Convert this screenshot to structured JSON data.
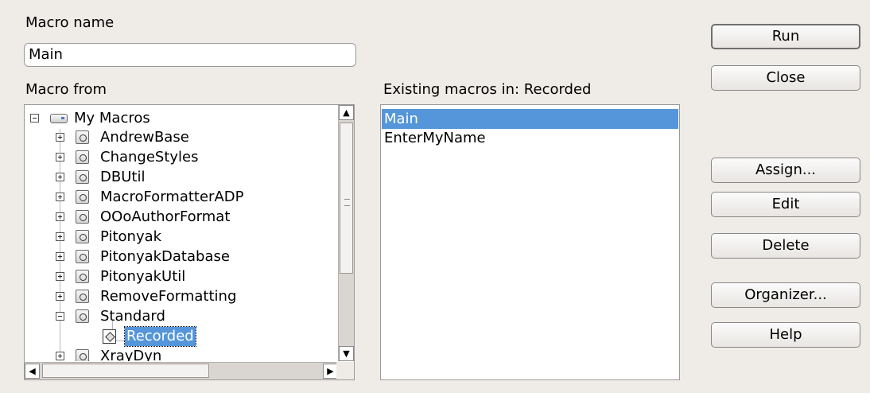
{
  "macro_name": {
    "label": "Macro name",
    "value": "Main"
  },
  "macro_from": {
    "label": "Macro from"
  },
  "tree": {
    "root": "My Macros",
    "libraries": [
      "AndrewBase",
      "ChangeStyles",
      "DBUtil",
      "MacroFormatterADP",
      "OOoAuthorFormat",
      "Pitonyak",
      "PitonyakDatabase",
      "PitonyakUtil",
      "RemoveFormatting",
      "Standard",
      "XrayDyn"
    ],
    "selected_module": "Recorded"
  },
  "existing_macros": {
    "label": "Existing macros in: Recorded",
    "items": [
      "Main",
      "EnterMyName"
    ],
    "selected": "Main"
  },
  "buttons": {
    "run": "Run",
    "close": "Close",
    "assign": "Assign...",
    "edit": "Edit",
    "delete": "Delete",
    "organizer": "Organizer...",
    "help": "Help"
  },
  "colors": {
    "selection": "#5496d9",
    "background": "#efebe7"
  },
  "icons": {
    "root": "drive-icon",
    "library": "library-icon",
    "module": "module-icon",
    "expand": "plus-icon",
    "collapse": "minus-icon"
  }
}
